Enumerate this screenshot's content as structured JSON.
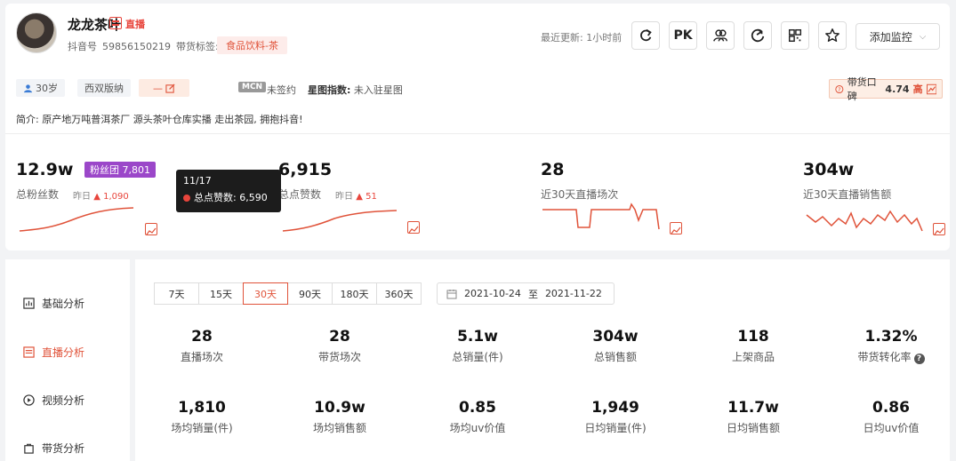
{
  "profile": {
    "name": "龙龙茶叶",
    "live_text": "直播",
    "douyin_label": "抖音号",
    "douyin_id": "59856150219",
    "tag_label": "带货标签:",
    "tag_value": "食品饮料-茶"
  },
  "header": {
    "update_text": "最近更新: 1小时前",
    "pk_label": "PK",
    "monitor_label": "添加监控",
    "icons": [
      "refresh-icon",
      "pk-icon",
      "users-icon",
      "sync-icon",
      "qrcode-icon",
      "star-icon",
      "chevron-down-icon"
    ]
  },
  "chips": {
    "age": "30岁",
    "region": "西双版纳",
    "dash": "—",
    "mcn_badge": "MCN",
    "mcn_status": "未签约",
    "star_label": "星图指数:",
    "star_value": "未入驻星图",
    "praise_label": "带货口碑",
    "praise_value": "4.74",
    "praise_level": "高"
  },
  "bio": "简介: 原产地万吨普洱茶厂 源头茶叶仓库实播 走出茶园, 拥抱抖音!",
  "stats": [
    {
      "value": "12.9w",
      "label": "总粉丝数",
      "yday_label": "昨日",
      "yday_value": "1,090"
    },
    {
      "value": "6,915",
      "label": "总点赞数",
      "yday_label": "昨日",
      "yday_value": "51"
    },
    {
      "value": "28",
      "label": "近30天直播场次"
    },
    {
      "value": "304w",
      "label": "近30天直播销售额"
    }
  ],
  "fans_group": "粉丝团 7,801",
  "tooltip": {
    "date": "11/17",
    "label": "总点赞数: 6,590"
  },
  "sidebar": [
    {
      "label": "基础分析"
    },
    {
      "label": "直播分析"
    },
    {
      "label": "视频分析"
    },
    {
      "label": "带货分析"
    }
  ],
  "tabs": [
    "7天",
    "15天",
    "30天",
    "90天",
    "180天",
    "360天"
  ],
  "active_tab": "30天",
  "date_range": {
    "start": "2021-10-24",
    "sep": "至",
    "end": "2021-11-22"
  },
  "metrics_row1": [
    {
      "value": "28",
      "label": "直播场次"
    },
    {
      "value": "28",
      "label": "带货场次"
    },
    {
      "value": "5.1w",
      "label": "总销量(件)"
    },
    {
      "value": "304w",
      "label": "总销售额"
    },
    {
      "value": "118",
      "label": "上架商品"
    },
    {
      "value": "1.32%",
      "label": "带货转化率"
    }
  ],
  "metrics_row2": [
    {
      "value": "1,810",
      "label": "场均销量(件)"
    },
    {
      "value": "10.9w",
      "label": "场均销售额"
    },
    {
      "value": "0.85",
      "label": "场均uv价值"
    },
    {
      "value": "1,949",
      "label": "日均销量(件)"
    },
    {
      "value": "11.7w",
      "label": "日均销售额"
    },
    {
      "value": "0.86",
      "label": "日均uv价值"
    }
  ],
  "colors": {
    "accent": "#e0533a",
    "purple": "#9b47c9",
    "dark_tooltip": "#1c1c1c"
  }
}
